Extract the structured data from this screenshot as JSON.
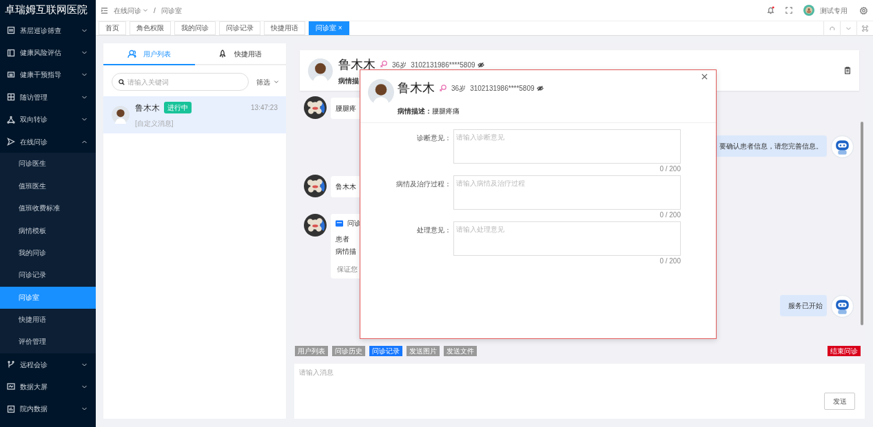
{
  "app": {
    "title": "卓瑞姆互联网医院"
  },
  "sidebar": {
    "items": [
      {
        "label": "基层巡诊筛查",
        "expanded": false
      },
      {
        "label": "健康风险评估",
        "expanded": false
      },
      {
        "label": "健康干预指导",
        "expanded": false
      },
      {
        "label": "随访管理",
        "expanded": false
      },
      {
        "label": "双向转诊",
        "expanded": false
      },
      {
        "label": "在线问诊",
        "expanded": true,
        "children": [
          {
            "label": "问诊医生",
            "selected": false
          },
          {
            "label": "值班医生",
            "selected": false
          },
          {
            "label": "值班收费标准",
            "selected": false
          },
          {
            "label": "病情模板",
            "selected": false
          },
          {
            "label": "我的问诊",
            "selected": false
          },
          {
            "label": "问诊记录",
            "selected": false
          },
          {
            "label": "问诊室",
            "selected": true
          },
          {
            "label": "快捷用语",
            "selected": false
          },
          {
            "label": "评价管理",
            "selected": false
          }
        ]
      },
      {
        "label": "远程会诊",
        "expanded": false
      },
      {
        "label": "数据大屏",
        "expanded": false
      },
      {
        "label": "院内数据",
        "expanded": false
      }
    ]
  },
  "header": {
    "breadcrumb": {
      "items": [
        "在线问诊",
        "问诊室"
      ],
      "separator": "/"
    },
    "unread_notifications": true,
    "user": {
      "name": "测试专用"
    }
  },
  "tabs": [
    {
      "label": "首页",
      "selected": false
    },
    {
      "label": "角色权限",
      "selected": false
    },
    {
      "label": "我的问诊",
      "selected": false
    },
    {
      "label": "问诊记录",
      "selected": false
    },
    {
      "label": "快捷用语",
      "selected": false
    },
    {
      "label": "问诊室",
      "selected": true,
      "close": "×"
    }
  ],
  "user_panel": {
    "tabs": [
      {
        "label": "用户列表",
        "selected": true
      },
      {
        "label": "快捷用语",
        "selected": false
      }
    ],
    "search": {
      "placeholder": "请输入关键词"
    },
    "filter": "筛选",
    "users": [
      {
        "name": "鲁木木",
        "status": "进行中",
        "time": "13:47:23",
        "message": "[自定义消息]",
        "selected": true
      }
    ]
  },
  "chat": {
    "patient": {
      "name": "鲁木木",
      "age": "36岁",
      "id_number": "3102131986****5809",
      "description": "病情描"
    },
    "messages": [
      {
        "outgoing": false,
        "kind": "text",
        "text": "腰腿疼"
      },
      {
        "outgoing": true,
        "kind": "text",
        "text": "要确认患者信息，请您完善信息。"
      },
      {
        "outgoing": false,
        "kind": "text",
        "text": "鲁木木"
      },
      {
        "outgoing": false,
        "kind": "card",
        "title": "问诊",
        "lines": [
          "患者",
          "病情描"
        ],
        "footer": "保证您"
      },
      {
        "outgoing": true,
        "kind": "text",
        "text": "服务已开始"
      }
    ],
    "actions": [
      {
        "label": "用户列表",
        "selected": false
      },
      {
        "label": "问诊历史",
        "selected": false
      },
      {
        "label": "问诊记录",
        "selected": true
      },
      {
        "label": "发送图片",
        "selected": false
      },
      {
        "label": "发送文件",
        "selected": false
      }
    ],
    "end_button": "结束问诊",
    "input": {
      "placeholder": "请输入消息"
    },
    "send_button": "发送"
  },
  "dialog": {
    "patient": {
      "name": "鲁木木",
      "age": "36岁",
      "id_number": "3102131986****5809",
      "description": "**病情描述：**腰腿疼痛"
    },
    "fields": [
      {
        "label": "诊断意见：",
        "placeholder": "请输入诊断意见",
        "counter": "0 / 200"
      },
      {
        "label": "病情及治疗过程：",
        "placeholder": "请输入病情及治疗过程",
        "counter": "0 / 200"
      },
      {
        "label": "处理意见：",
        "placeholder": "请输入处理意见",
        "counter": "0 / 200"
      }
    ]
  }
}
